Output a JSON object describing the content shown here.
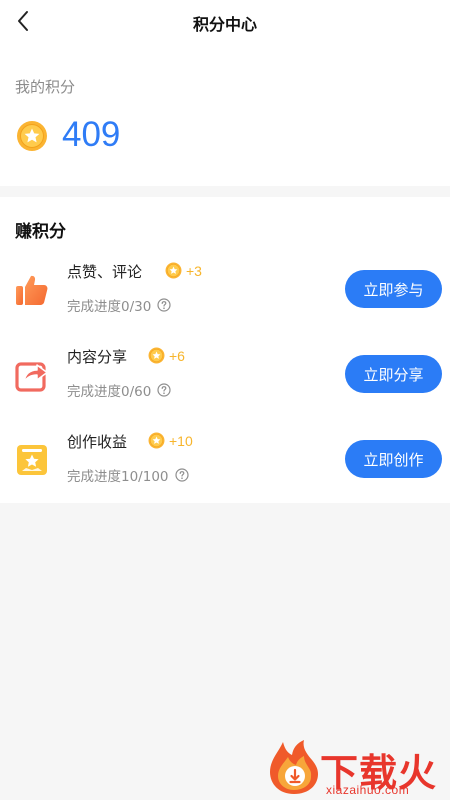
{
  "header": {
    "title": "积分中心"
  },
  "points": {
    "label": "我的积分",
    "value": "409"
  },
  "earn": {
    "title": "赚积分",
    "tasks": [
      {
        "name": "点赞、评论",
        "reward": "+3",
        "progress": "完成进度0/30",
        "button": "立即参与",
        "icon": "thumbs-up-icon"
      },
      {
        "name": "内容分享",
        "reward": "+6",
        "progress": "完成进度0/60",
        "button": "立即分享",
        "icon": "share-icon"
      },
      {
        "name": "创作收益",
        "reward": "+10",
        "progress": "完成进度10/100",
        "button": "立即创作",
        "icon": "star-ribbon-icon"
      }
    ]
  },
  "watermark": {
    "cn": "下载火",
    "en": "xiazaihuo.com"
  },
  "colors": {
    "accent": "#2b7cf6",
    "points_value": "#2f7cf6",
    "reward": "#f7b52c",
    "watermark": "#e8362c"
  }
}
